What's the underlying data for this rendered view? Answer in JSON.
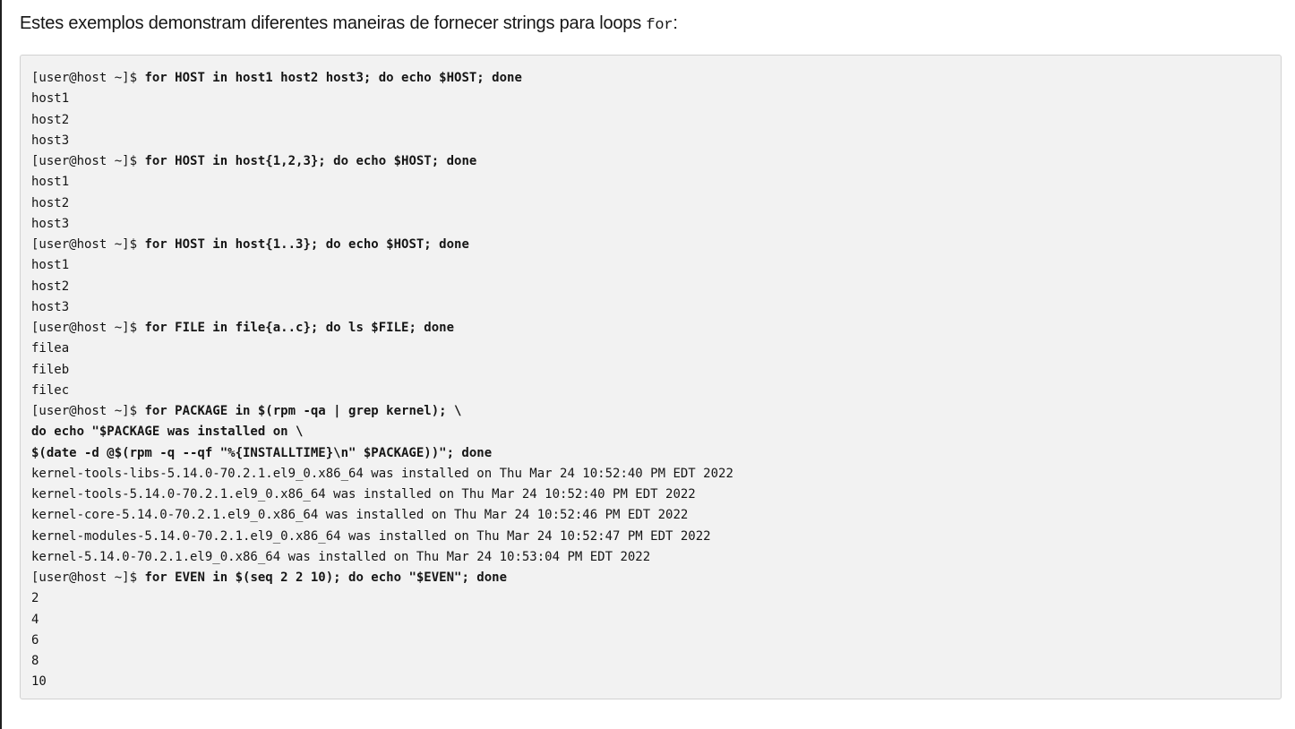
{
  "intro": {
    "text": "Estes exemplos demonstram diferentes maneiras de fornecer strings para loops ",
    "code": "for",
    "suffix": ":"
  },
  "code_lines": [
    {
      "prompt": "[user@host ~]$ ",
      "command": "for HOST in host1 host2 host3; do echo $HOST; done",
      "output": ""
    },
    {
      "prompt": "",
      "command": "",
      "output": "host1"
    },
    {
      "prompt": "",
      "command": "",
      "output": "host2"
    },
    {
      "prompt": "",
      "command": "",
      "output": "host3"
    },
    {
      "prompt": "[user@host ~]$ ",
      "command": "for HOST in host{1,2,3}; do echo $HOST; done",
      "output": ""
    },
    {
      "prompt": "",
      "command": "",
      "output": "host1"
    },
    {
      "prompt": "",
      "command": "",
      "output": "host2"
    },
    {
      "prompt": "",
      "command": "",
      "output": "host3"
    },
    {
      "prompt": "[user@host ~]$ ",
      "command": "for HOST in host{1..3}; do echo $HOST; done",
      "output": ""
    },
    {
      "prompt": "",
      "command": "",
      "output": "host1"
    },
    {
      "prompt": "",
      "command": "",
      "output": "host2"
    },
    {
      "prompt": "",
      "command": "",
      "output": "host3"
    },
    {
      "prompt": "[user@host ~]$ ",
      "command": "for FILE in file{a..c}; do ls $FILE; done",
      "output": ""
    },
    {
      "prompt": "",
      "command": "",
      "output": "filea"
    },
    {
      "prompt": "",
      "command": "",
      "output": "fileb"
    },
    {
      "prompt": "",
      "command": "",
      "output": "filec"
    },
    {
      "prompt": "[user@host ~]$ ",
      "command": "for PACKAGE in $(rpm -qa | grep kernel); \\",
      "output": ""
    },
    {
      "prompt": "",
      "command": "do echo \"$PACKAGE was installed on \\",
      "output": ""
    },
    {
      "prompt": "",
      "command": "$(date -d @$(rpm -q --qf \"%{INSTALLTIME}\\n\" $PACKAGE))\"; done",
      "output": ""
    },
    {
      "prompt": "",
      "command": "",
      "output": "kernel-tools-libs-5.14.0-70.2.1.el9_0.x86_64 was installed on Thu Mar 24 10:52:40 PM EDT 2022"
    },
    {
      "prompt": "",
      "command": "",
      "output": "kernel-tools-5.14.0-70.2.1.el9_0.x86_64 was installed on Thu Mar 24 10:52:40 PM EDT 2022"
    },
    {
      "prompt": "",
      "command": "",
      "output": "kernel-core-5.14.0-70.2.1.el9_0.x86_64 was installed on Thu Mar 24 10:52:46 PM EDT 2022"
    },
    {
      "prompt": "",
      "command": "",
      "output": "kernel-modules-5.14.0-70.2.1.el9_0.x86_64 was installed on Thu Mar 24 10:52:47 PM EDT 2022"
    },
    {
      "prompt": "",
      "command": "",
      "output": "kernel-5.14.0-70.2.1.el9_0.x86_64 was installed on Thu Mar 24 10:53:04 PM EDT 2022"
    },
    {
      "prompt": "[user@host ~]$ ",
      "command": "for EVEN in $(seq 2 2 10); do echo \"$EVEN\"; done",
      "output": ""
    },
    {
      "prompt": "",
      "command": "",
      "output": "2"
    },
    {
      "prompt": "",
      "command": "",
      "output": "4"
    },
    {
      "prompt": "",
      "command": "",
      "output": "6"
    },
    {
      "prompt": "",
      "command": "",
      "output": "8"
    },
    {
      "prompt": "",
      "command": "",
      "output": "10"
    }
  ]
}
